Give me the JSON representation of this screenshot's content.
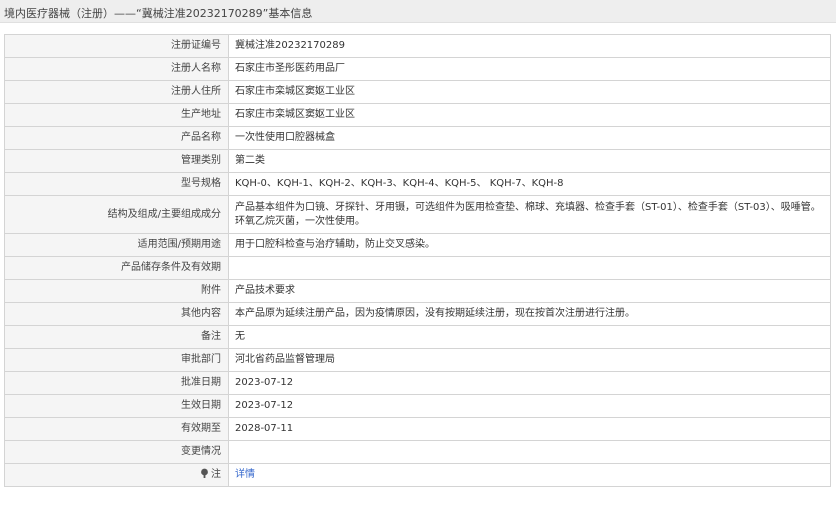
{
  "header": {
    "title": "境内医疗器械（注册）——“冀械注准20232170289”基本信息"
  },
  "rows": [
    {
      "label": "注册证编号",
      "value": "冀械注准20232170289"
    },
    {
      "label": "注册人名称",
      "value": "石家庄市圣彤医药用品厂"
    },
    {
      "label": "注册人住所",
      "value": "石家庄市栾城区窦妪工业区"
    },
    {
      "label": "生产地址",
      "value": "石家庄市栾城区窦妪工业区"
    },
    {
      "label": "产品名称",
      "value": "一次性使用口腔器械盒"
    },
    {
      "label": "管理类别",
      "value": "第二类"
    },
    {
      "label": "型号规格",
      "value": "KQH-0、KQH-1、KQH-2、KQH-3、KQH-4、KQH-5、 KQH-7、KQH-8"
    },
    {
      "label": "结构及组成/主要组成成分",
      "value": "产品基本组件为口镜、牙探针、牙用镊，可选组件为医用检查垫、棉球、充填器、检查手套（ST-01）、检查手套（ST-03）、吸唾管。环氧乙烷灭菌，一次性使用。"
    },
    {
      "label": "适用范围/预期用途",
      "value": "用于口腔科检查与治疗辅助，防止交叉感染。"
    },
    {
      "label": "产品储存条件及有效期",
      "value": ""
    },
    {
      "label": "附件",
      "value": "产品技术要求"
    },
    {
      "label": "其他内容",
      "value": "本产品原为延续注册产品，因为疫情原因，没有按期延续注册，现在按首次注册进行注册。"
    },
    {
      "label": "备注",
      "value": "无"
    },
    {
      "label": "审批部门",
      "value": "河北省药品监督管理局"
    },
    {
      "label": "批准日期",
      "value": "2023-07-12"
    },
    {
      "label": "生效日期",
      "value": "2023-07-12"
    },
    {
      "label": "有效期至",
      "value": "2028-07-11"
    },
    {
      "label": "变更情况",
      "value": ""
    },
    {
      "label": "注",
      "value": "详情",
      "icon": "info-icon"
    }
  ],
  "colors": {
    "header_bg": "#eeeeee",
    "label_bg": "#f5f5f5",
    "border": "#d4d4d4",
    "link": "#3366cc"
  }
}
